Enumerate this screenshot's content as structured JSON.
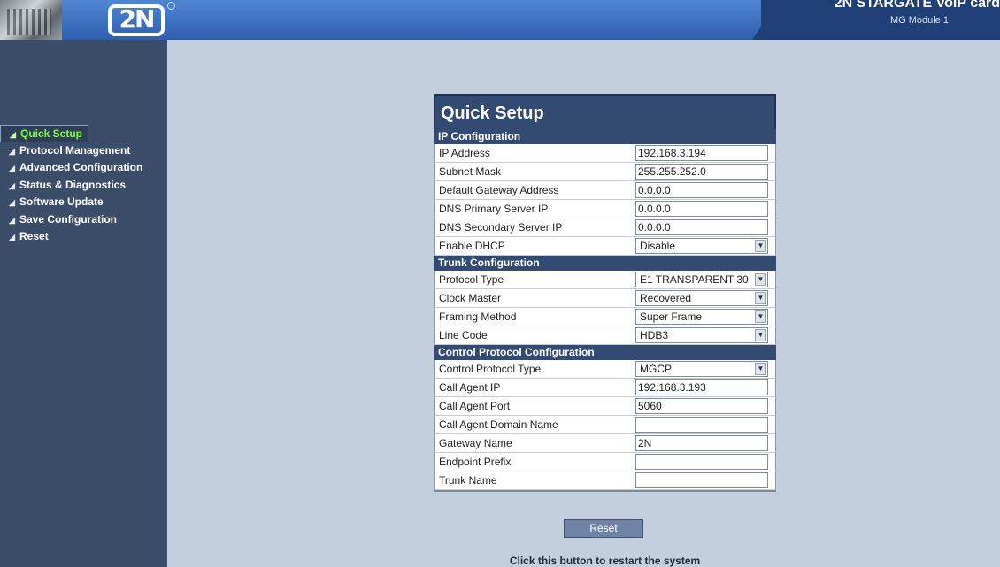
{
  "header": {
    "logo_text": "2N",
    "product_name": "2N STARGATE VoIP card",
    "module_name": "MG Module 1"
  },
  "sidebar": {
    "items": [
      {
        "label": "Quick Setup",
        "active": true
      },
      {
        "label": "Protocol Management"
      },
      {
        "label": "Advanced Configuration"
      },
      {
        "label": "Status & Diagnostics"
      },
      {
        "label": "Software Update"
      },
      {
        "label": "Save Configuration"
      },
      {
        "label": "Reset"
      }
    ]
  },
  "form": {
    "title": "Quick Setup",
    "ip_section": "IP Configuration",
    "ip_address": {
      "label": "IP Address",
      "value": "192.168.3.194"
    },
    "subnet_mask": {
      "label": "Subnet Mask",
      "value": "255.255.252.0"
    },
    "default_gateway": {
      "label": "Default Gateway Address",
      "value": "0.0.0.0"
    },
    "dns_primary": {
      "label": "DNS Primary Server IP",
      "value": "0.0.0.0"
    },
    "dns_secondary": {
      "label": "DNS Secondary Server IP",
      "value": "0.0.0.0"
    },
    "enable_dhcp": {
      "label": "Enable DHCP",
      "value": "Disable"
    },
    "trunk_section": "Trunk Configuration",
    "protocol_type": {
      "label": "Protocol Type",
      "value": "E1 TRANSPARENT 30"
    },
    "clock_master": {
      "label": "Clock Master",
      "value": "Recovered"
    },
    "framing_method": {
      "label": "Framing Method",
      "value": "Super Frame"
    },
    "line_code": {
      "label": "Line Code",
      "value": "HDB3"
    },
    "control_section": "Control Protocol Configuration",
    "control_protocol_type": {
      "label": "Control Protocol Type",
      "value": "MGCP"
    },
    "call_agent_ip": {
      "label": "Call Agent IP",
      "value": "192.168.3.193"
    },
    "call_agent_port": {
      "label": "Call Agent Port",
      "value": "5060"
    },
    "call_agent_domain": {
      "label": "Call Agent Domain Name",
      "value": ""
    },
    "gateway_name": {
      "label": "Gateway Name",
      "value": "2N"
    },
    "endpoint_prefix": {
      "label": "Endpoint Prefix",
      "value": ""
    },
    "trunk_name": {
      "label": "Trunk Name",
      "value": ""
    }
  },
  "reset": {
    "button_label": "Reset",
    "note": "Click this button to restart the system"
  },
  "icons": {
    "nav_bullet": "arrow-bullet-icon",
    "select_arrow": "chevron-down-icon"
  }
}
